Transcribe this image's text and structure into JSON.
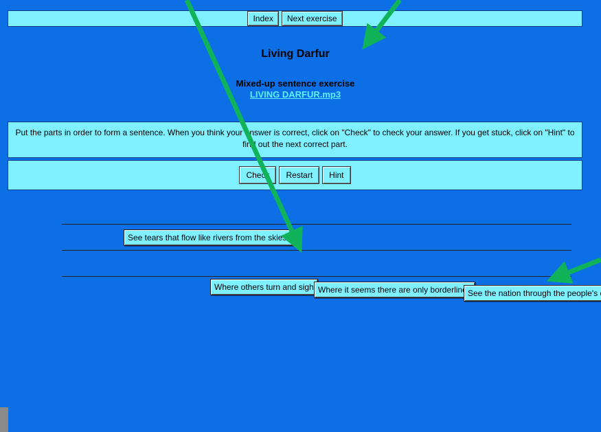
{
  "nav": {
    "index_label": "Index",
    "next_label": "Next exercise"
  },
  "header": {
    "title": "Living Darfur",
    "subtitle": "Mixed-up sentence exercise",
    "audio_link": "LIVING DARFUR.mp3"
  },
  "instructions": "Put the parts in order to form a sentence. When you think your answer is correct, click on \"Check\" to check your answer. If you get stuck, click on \"Hint\" to find out the next correct part.",
  "controls": {
    "check_label": "Check",
    "restart_label": "Restart",
    "hint_label": "Hint"
  },
  "answer": {
    "placed_parts": [
      "See tears that flow like rivers from the skies."
    ]
  },
  "pool": {
    "parts": [
      "Where others turn and sigh",
      "Where it seems there are only borderlines",
      "See the nation through the people's eyes"
    ]
  },
  "colors": {
    "background": "#0d6fe6",
    "panel": "#7ef0ff",
    "link": "#5ff0ff",
    "arrow": "#11b35a"
  }
}
